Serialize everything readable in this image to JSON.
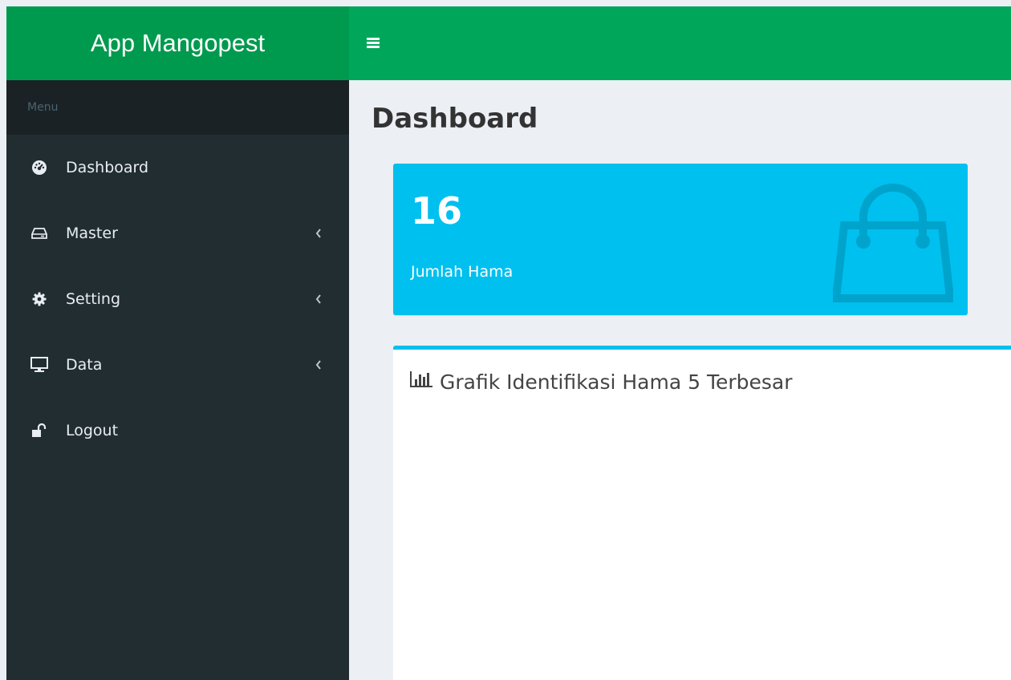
{
  "app": {
    "title": "App Mangopest"
  },
  "sidebar": {
    "header": "Menu",
    "items": [
      {
        "label": "Dashboard",
        "icon": "dashboard-icon",
        "has_submenu": false
      },
      {
        "label": "Master",
        "icon": "hdd-icon",
        "has_submenu": true
      },
      {
        "label": "Setting",
        "icon": "gear-icon",
        "has_submenu": true
      },
      {
        "label": "Data",
        "icon": "monitor-icon",
        "has_submenu": true
      },
      {
        "label": "Logout",
        "icon": "unlock-icon",
        "has_submenu": false
      }
    ]
  },
  "page": {
    "title": "Dashboard"
  },
  "stat_box": {
    "value": "16",
    "label": "Jumlah Hama",
    "icon": "shopping-bag-icon",
    "color": "#00c0ef"
  },
  "chart_panel": {
    "title": "Grafik Identifikasi Hama 5 Terbesar",
    "icon": "bar-chart-icon"
  },
  "colors": {
    "header_green": "#00a65a",
    "logo_green": "#009a4e",
    "sidebar": "#222d32",
    "accent": "#00c0ef"
  }
}
